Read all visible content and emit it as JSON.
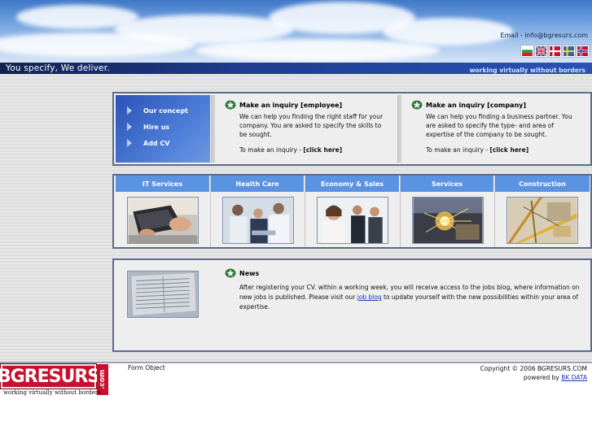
{
  "header": {
    "email": "Email - info@bgresurs.com",
    "slogan": "You specify, We deliver.",
    "tagline": "working virtually without borders",
    "flags": [
      {
        "name": "bulgaria-flag-icon",
        "colors": [
          "#ffffff",
          "#2e9a3c",
          "#d3202a"
        ]
      },
      {
        "name": "uk-flag-icon",
        "colors": [
          "#2a3c8f",
          "#ffffff",
          "#cf1f2f"
        ]
      },
      {
        "name": "denmark-flag-icon",
        "colors": [
          "#c8102e",
          "#ffffff"
        ]
      },
      {
        "name": "sweden-flag-icon",
        "colors": [
          "#2c63b5",
          "#f7d117"
        ]
      },
      {
        "name": "norway-flag-icon",
        "colors": [
          "#c8102e",
          "#ffffff",
          "#1f3c8c"
        ]
      }
    ]
  },
  "nav": {
    "items": [
      {
        "label": "Our concept"
      },
      {
        "label": "Hire us"
      },
      {
        "label": "Add CV"
      }
    ]
  },
  "inquiries": [
    {
      "title": "Make an inquiry [employee]",
      "text": "We can help you finding the right staff for your company. You are asked to specify the skills to be sought.",
      "link_prefix": "To make an inquiry - ",
      "link_label": "[click here]"
    },
    {
      "title": "Make an inquiry [company]",
      "text": "We can help you finding a business partner. You are asked to specify the type- and area of expertise of the company to be sought.",
      "link_prefix": "To make an inquiry - ",
      "link_label": "[click here]"
    }
  ],
  "categories": [
    {
      "label": "IT Services",
      "icon": "laptop-keyboard-photo"
    },
    {
      "label": "Health Care",
      "icon": "medical-team-photo"
    },
    {
      "label": "Economy & Sales",
      "icon": "business-people-photo"
    },
    {
      "label": "Services",
      "icon": "welding-sparks-photo"
    },
    {
      "label": "Construction",
      "icon": "construction-tools-photo"
    }
  ],
  "news": {
    "title": "News",
    "text_before": "After registering your CV. within a working week, you will receive access to the jobs blog, where information on new jobs is published. Please visit our ",
    "link": "job blog",
    "text_after": " to update yourself with the new possibilities within your area of expertise."
  },
  "footer": {
    "logo_text": "BGRESURS",
    "logo_suffix": ".com",
    "logo_tagline": "working virtually without borders",
    "form_object": "Form Object",
    "copyright": "Copyright © 2006 BGRESURS.COM",
    "powered_prefix": "powered by ",
    "powered_link": "BK DATA"
  },
  "colors": {
    "accent_blue": "#5b93e3",
    "nav_blue": "#2c53b6",
    "panel_border": "#5b6b8c",
    "brand_red": "#c8102e",
    "header_bar": "#1f3c8c"
  }
}
